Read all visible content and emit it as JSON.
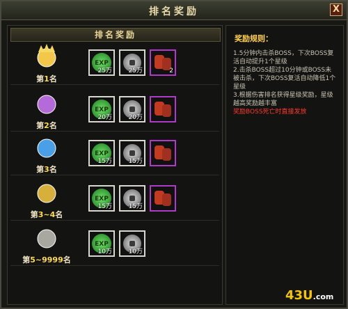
{
  "window": {
    "title": "排名奖励",
    "close_label": "X"
  },
  "left_panel": {
    "header": "排名奖励"
  },
  "ranks": [
    {
      "prefix": "第",
      "num": "1",
      "suffix": "名",
      "color": "#f3c84a",
      "rewards": [
        {
          "type": "exp",
          "label": "25万"
        },
        {
          "type": "coin",
          "label": "25万"
        },
        {
          "type": "bag",
          "label": "2"
        }
      ]
    },
    {
      "prefix": "第",
      "num": "2",
      "suffix": "名",
      "color": "#b46ad8",
      "rewards": [
        {
          "type": "exp",
          "label": "20万"
        },
        {
          "type": "coin",
          "label": "20万"
        },
        {
          "type": "bag",
          "label": ""
        }
      ]
    },
    {
      "prefix": "第",
      "num": "3",
      "suffix": "名",
      "color": "#4aa0e6",
      "rewards": [
        {
          "type": "exp",
          "label": "15万"
        },
        {
          "type": "coin",
          "label": "15万"
        },
        {
          "type": "bag",
          "label": ""
        }
      ]
    },
    {
      "prefix": "第",
      "num": "3~4",
      "suffix": "名",
      "color": "#d6b03a",
      "rewards": [
        {
          "type": "exp",
          "label": "15万"
        },
        {
          "type": "coin",
          "label": "15万"
        },
        {
          "type": "bag",
          "label": ""
        }
      ]
    },
    {
      "prefix": "第",
      "num": "5~9999",
      "suffix": "名",
      "color": "#a8a8a0",
      "rewards": [
        {
          "type": "exp",
          "label": "10万"
        },
        {
          "type": "coin",
          "label": "10万"
        }
      ]
    }
  ],
  "exp_text": "EXP",
  "rules": {
    "title": "奖励规则：",
    "lines": [
      "1.5分钟内击杀BOSS，下次BOSS复活自动提升1个星级",
      "2.击杀BOSS超过10分钟或BOSS未被击杀，下次BOSS复活自动降低1个星级",
      "3.根据伤害排名获得星级奖励，星级越高奖励越丰富"
    ],
    "warning": "奖励BOSS死亡时直接发放"
  },
  "logo": {
    "main": "43U",
    "suffix": ".com"
  }
}
